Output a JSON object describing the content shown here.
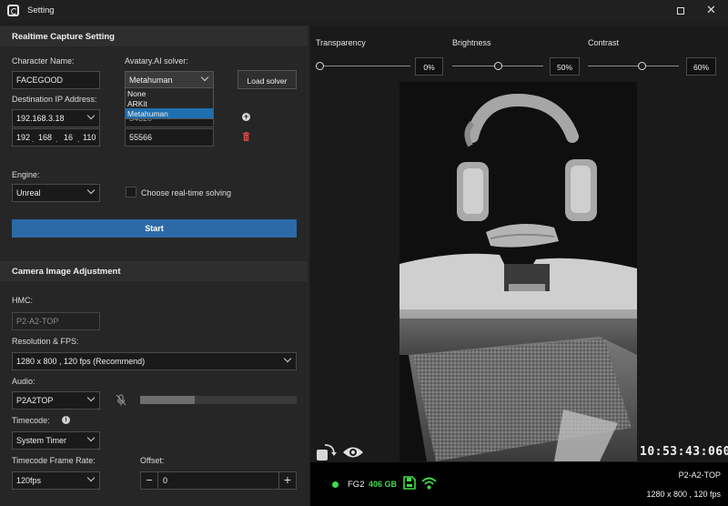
{
  "window": {
    "title": "Setting"
  },
  "realtime": {
    "section_title": "Realtime Capture Setting",
    "character_name_label": "Character Name:",
    "character_name_value": "FACEGOOD",
    "solver_label": "Avatary.AI solver:",
    "solver_selected": "Metahuman",
    "solver_options": [
      "None",
      "ARKit",
      "Metahuman"
    ],
    "load_solver_label": "Load solver",
    "dest_ip_label": "Destination IP Address:",
    "dest_ip_select": "192.168.3.18",
    "ip_octets": [
      "192",
      "168",
      "16",
      "110"
    ],
    "port_partial": "54320",
    "port_value": "55566",
    "engine_label": "Engine:",
    "engine_value": "Unreal",
    "realtime_solving_label": "Choose real-time solving",
    "start_label": "Start"
  },
  "camera": {
    "section_title": "Camera Image Adjustment",
    "hmc_label": "HMC:",
    "hmc_value": "P2-A2-TOP",
    "res_fps_label": "Resolution & FPS:",
    "res_fps_value": "1280 x 800 , 120 fps (Recommend)",
    "audio_label": "Audio:",
    "audio_value": "P2A2TOP",
    "audio_level": 0.35,
    "timecode_label": "Timecode:",
    "timecode_value": "System Timer",
    "tc_frame_rate_label": "Timecode Frame Rate:",
    "tc_frame_rate_value": "120fps",
    "offset_label": "Offset:",
    "offset_value": "0",
    "minus_glyph": "−",
    "plus_glyph": "+"
  },
  "adjust": {
    "transparency_label": "Transparency",
    "transparency_value": "0%",
    "brightness_label": "Brightness",
    "brightness_value": "50%",
    "contrast_label": "Contrast",
    "contrast_value": "60%"
  },
  "preview": {
    "timecode": "10:53:43:060"
  },
  "status": {
    "device": "FG2",
    "storage": "406 GB",
    "camera_name": "P2-A2-TOP",
    "camera_res": "1280 x 800 , 120 fps"
  },
  "icons": {
    "app": "app-logo-icon",
    "add": "add-circle-icon",
    "trash": "trash-icon",
    "info": "info-icon",
    "mic": "mic-muted-icon",
    "rotate": "rotate-icon",
    "eye": "eye-icon",
    "sd": "sd-card-icon",
    "wifi": "wifi-icon"
  },
  "colors": {
    "accent": "#2c6aa6",
    "status_green": "#3ddc4a",
    "delete_red": "#e24a4a"
  }
}
